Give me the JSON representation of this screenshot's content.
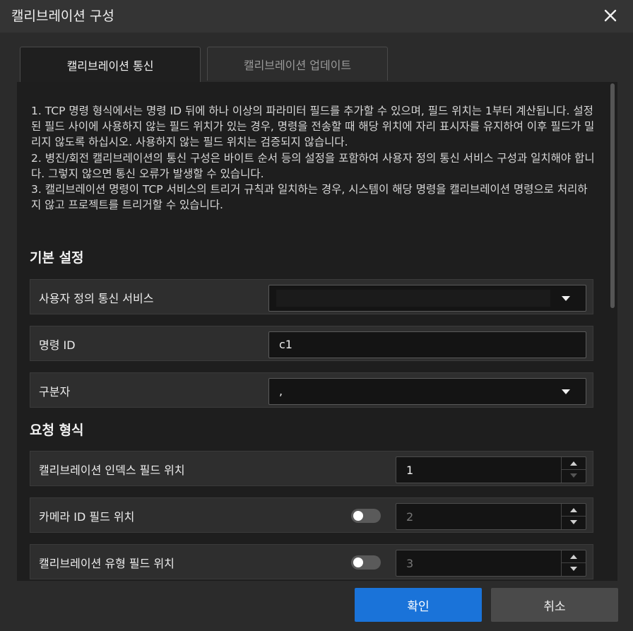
{
  "window": {
    "title": "캘리브레이션 구성",
    "close_icon": "close-icon"
  },
  "tabs": [
    {
      "label": "캘리브레이션 통신",
      "active": true
    },
    {
      "label": "캘리브레이션 업데이트",
      "active": false
    }
  ],
  "info": [
    "1. TCP 명령 형식에서는 명령 ID 뒤에 하나 이상의 파라미터 필드를 추가할 수 있으며, 필드 위치는 1부터 계산됩니다. 설정된 필드 사이에 사용하지 않는 필드 위치가 있는 경우, 명령을 전송할 때 해당 위치에 자리 표시자를 유지하여 이후 필드가 밀리지 않도록 하십시오. 사용하지 않는 필드 위치는 검증되지 않습니다.",
    "2. 병진/회전 캘리브레이션의 통신 구성은 바이트 순서 등의 설정을 포함하여 사용자 정의 통신 서비스 구성과 일치해야 합니다. 그렇지 않으면 통신 오류가 발생할 수 있습니다.",
    "3. 캘리브레이션 명령이 TCP 서비스의 트리거 규칙과 일치하는 경우, 시스템이 해당 명령을 캘리브레이션 명령으로 처리하지 않고 프로젝트를 트리거할 수 있습니다."
  ],
  "basic": {
    "title": "기본 설정",
    "service": {
      "label": "사용자 정의 통신 서비스",
      "value": ""
    },
    "command_id": {
      "label": "명령 ID",
      "value": "c1"
    },
    "separator": {
      "label": "구분자",
      "value": ","
    }
  },
  "request": {
    "title": "요청 형식",
    "index_field": {
      "label": "캘리브레이션 인덱스 필드 위치",
      "value": "1"
    },
    "camera_field": {
      "label": "카메라 ID 필드 위치",
      "value": "2",
      "enabled": false
    },
    "type_field": {
      "label": "캘리브레이션 유형 필드 위치",
      "value": "3",
      "enabled": false
    }
  },
  "footer": {
    "ok_label": "확인",
    "cancel_label": "취소"
  },
  "colors": {
    "accent": "#1a73d9",
    "panel": "#1e1e1e",
    "background": "#2b2b2b"
  }
}
